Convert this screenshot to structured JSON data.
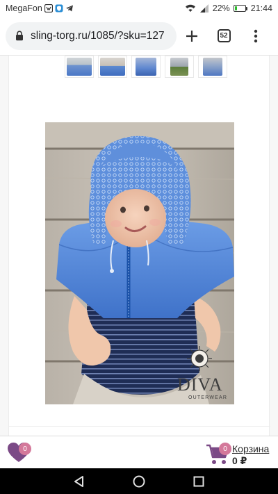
{
  "status_bar": {
    "carrier": "MegaFon",
    "battery_percent": "22%",
    "battery_level": 0.22,
    "time": "21:44",
    "icons": [
      "vk-icon",
      "shield-icon",
      "telegram-icon",
      "wifi-icon",
      "signal-icon",
      "battery-icon"
    ]
  },
  "browser": {
    "url": "sling-torg.ru/1085/?sku=127",
    "tab_count": "52",
    "icons": [
      "lock-icon",
      "plus-icon",
      "tabs-icon",
      "menu-dots-icon"
    ]
  },
  "gallery": {
    "thumbnail_count": 5,
    "main_image_logo": "DIVA",
    "main_image_logo_sub": "OUTERWEAR"
  },
  "bottom_bar": {
    "wishlist_count": "0",
    "cart_count": "0",
    "cart_label": "Корзина",
    "cart_total": "0 ₽"
  },
  "colors": {
    "accent_pink": "#d4789a",
    "heart_purple": "#7b4a86",
    "product_blue": "#4f84d6"
  }
}
